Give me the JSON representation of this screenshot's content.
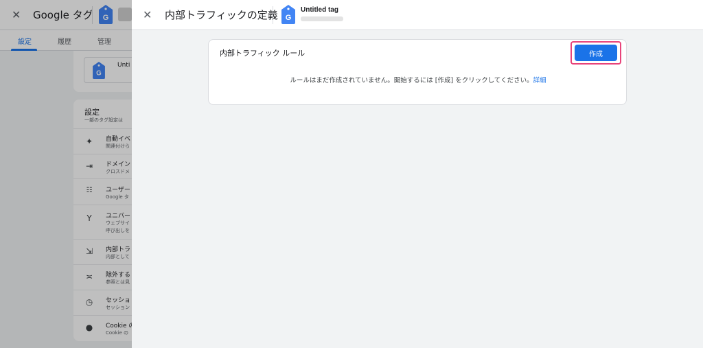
{
  "background": {
    "header": {
      "close_icon": "close-icon",
      "title": "Google タグ"
    },
    "tabs": [
      {
        "label": "設定",
        "active": true
      },
      {
        "label": "履歴",
        "active": false
      },
      {
        "label": "管理",
        "active": false
      }
    ],
    "tag_card": {
      "name": "Unti"
    },
    "settings": {
      "title": "設定",
      "subtitle": "一部のタグ設定は",
      "items": [
        {
          "icon": "sparkle-icon",
          "name": "自動イベ",
          "desc": "関連付けら"
        },
        {
          "icon": "merge-arrows-icon",
          "name": "ドメイン",
          "desc": "クロスドメ"
        },
        {
          "icon": "user-list-icon",
          "name": "ユーザー",
          "desc": "Google タ"
        },
        {
          "icon": "fork-icon",
          "name": "ユニバー",
          "desc": "ウェブサイ",
          "desc2": "呼び出しを"
        },
        {
          "icon": "sign-in-icon",
          "name": "内部トラ",
          "desc": "内部として"
        },
        {
          "icon": "exclude-icon",
          "name": "除外する",
          "desc": "参照とは見"
        },
        {
          "icon": "clock-icon",
          "name": "セッショ",
          "desc": "セッション"
        },
        {
          "icon": "cookie-icon",
          "name": "Cookie の",
          "desc": "Cookie の"
        }
      ]
    }
  },
  "panel": {
    "header": {
      "close_icon": "close-icon",
      "title": "内部トラフィックの定義",
      "tag_icon": "google-tag-icon",
      "tag_name": "Untitled tag"
    },
    "rule_card": {
      "title": "内部トラフィック ルール",
      "create_button": "作成",
      "empty_message": "ルールはまだ作成されていません。開始するには [作成] をクリックしてください。",
      "details_link": "詳細"
    }
  },
  "colors": {
    "accent": "#1a73e8",
    "highlight": "#e8437a"
  }
}
